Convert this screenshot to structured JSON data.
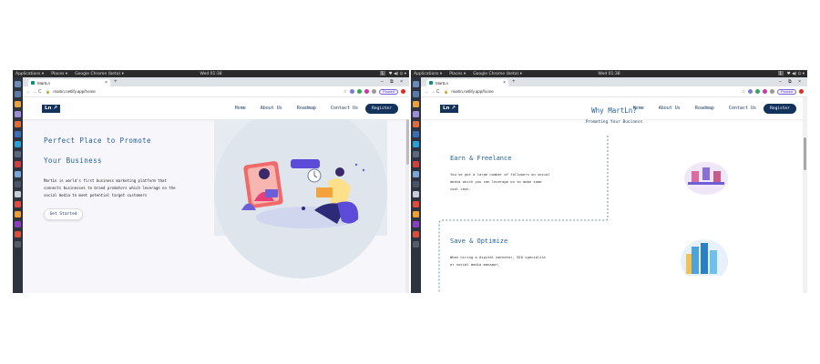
{
  "os": {
    "menu_applications": "Applications ▾",
    "menu_places": "Places ▾",
    "menu_app": "Google Chrome (beta) ▾",
    "clock_left": "Wed 01:38",
    "clock_right": "Wed 01:38",
    "workspace": "1",
    "tray_icons": "♥ ◀) ⏻ ▾"
  },
  "browser": {
    "tab_title": "MartLn",
    "tab_close": "×",
    "new_tab": "+",
    "window_controls": "– ⧉ ×",
    "nav_icons": "← → C",
    "lock_icon": "🔒",
    "url": "martin.netlify.app/home",
    "paused_label": "Paused",
    "ext_colors": [
      "#7b7bd8",
      "#34a853",
      "#c837ab",
      "#999999"
    ]
  },
  "site": {
    "logo": "Ln ↗",
    "nav": [
      "Home",
      "About Us",
      "Roadmap",
      "Contact Us"
    ],
    "register": "Register"
  },
  "hero": {
    "title_line1": "Perfect Place to Promote",
    "title_line2": "Your Business",
    "description": "MartLn is world's first business marketing platform that connects businesses to brand promotors which leverage on the social media to meet potential target customers",
    "cta": "Get Started"
  },
  "why": {
    "title": "Why MartLn?",
    "subtitle": "Promoting Your Business",
    "sections": [
      {
        "title": "Earn & Freelance",
        "desc": "You've got a large number of followers on social media which you can leverage on to make some cool cash."
      },
      {
        "title": "Save & Optimize",
        "desc": "When hiring a digital marketer, SEO specialist or social media manager,"
      }
    ]
  },
  "colors": {
    "brand_navy": "#14335c",
    "heading_blue": "#1f5d96",
    "hero_bg_circle": "#dfe5ec"
  }
}
